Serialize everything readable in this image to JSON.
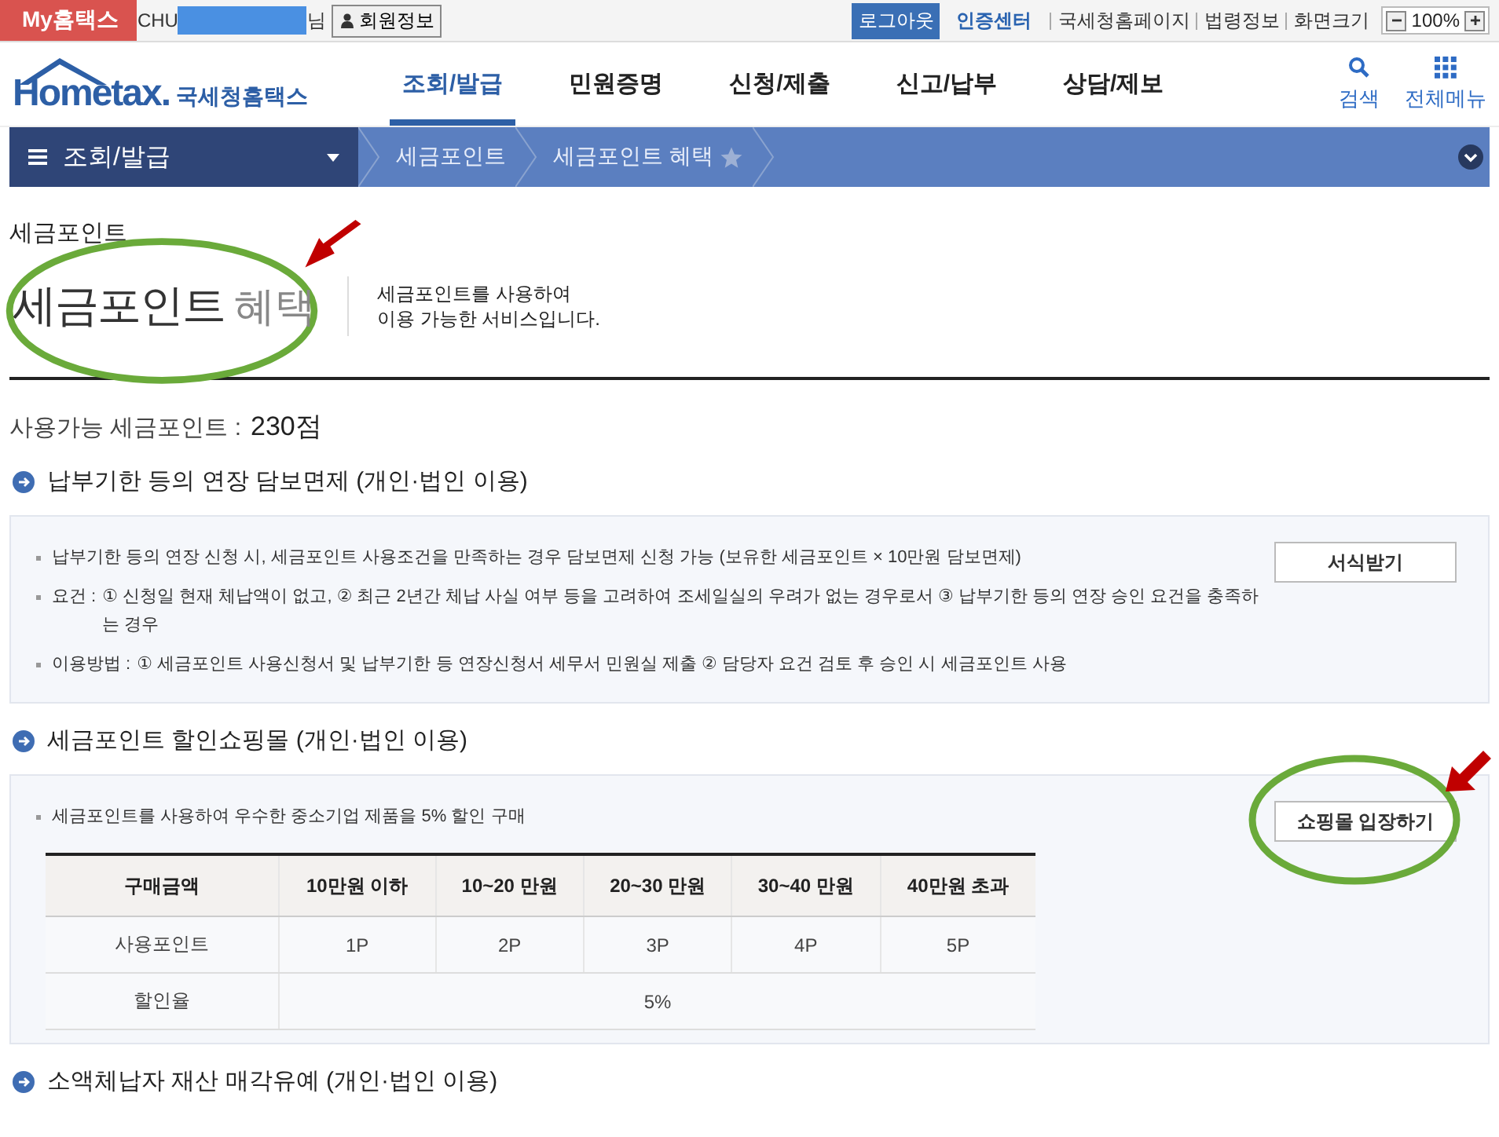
{
  "topbar": {
    "brand": "My홈택스",
    "user": "CHU",
    "user_suffix": "님",
    "member_button": "회원정보",
    "logout": "로그아웃",
    "cert": "인증센터",
    "links": [
      "국세청홈페이지",
      "법령정보",
      "화면크기"
    ],
    "zoom": "100%"
  },
  "header": {
    "logo_text": "Hometax.",
    "logo_name": "국세청홈택스",
    "menu": [
      {
        "label": "조회/발급",
        "selected": true
      },
      {
        "label": "민원증명",
        "selected": false
      },
      {
        "label": "신청/제출",
        "selected": false
      },
      {
        "label": "신고/납부",
        "selected": false
      },
      {
        "label": "상담/제보",
        "selected": false
      }
    ],
    "search": "검색",
    "all_menu": "전체메뉴"
  },
  "breadcrumb": {
    "menu": "조회/발급",
    "items": [
      "세금포인트",
      "세금포인트 혜택"
    ]
  },
  "page": {
    "section_label": "세금포인트",
    "title": "세금포인트",
    "title_sub": "혜택",
    "highlighted": true,
    "description": [
      "세금포인트를 사용하여",
      "이용 가능한 서비스입니다."
    ],
    "points_label": "사용가능 세금포인트 :",
    "points_value": "230점"
  },
  "sections": [
    {
      "title": "납부기한 등의 연장 담보면제 (개인·법인 이용)",
      "button": "서식받기",
      "button_highlighted": false,
      "bullets": [
        {
          "text": "납부기한 등의 연장 신청 시, 세금포인트 사용조건을 만족하는 경우 담보면제 신청 가능 (보유한 세금포인트 × 10만원 담보면제)"
        },
        {
          "label": "요건 :",
          "text": "① 신청일 현재 체납액이 없고, ② 최근 2년간 체납 사실 여부 등을 고려하여 조세일실의 우려가 없는 경우로서 ③ 납부기한 등의 연장 승인 요건을 충족하는 경우"
        },
        {
          "label": "이용방법 :",
          "text": "① 세금포인트 사용신청서 및 납부기한 등 연장신청서 세무서 민원실 제출 ② 담당자 요건 검토 후 승인 시 세금포인트 사용"
        }
      ]
    },
    {
      "title": "세금포인트 할인쇼핑몰 (개인·법인 이용)",
      "button": "쇼핑몰 입장하기",
      "button_highlighted": true,
      "bullets": [
        {
          "text": "세금포인트를 사용하여 우수한 중소기업 제품을 5% 할인 구매"
        }
      ],
      "table": {
        "columns": [
          "구매금액",
          "10만원 이하",
          "10~20 만원",
          "20~30 만원",
          "30~40 만원",
          "40만원 초과"
        ],
        "rows": [
          [
            "사용포인트",
            "1P",
            "2P",
            "3P",
            "4P",
            "5P"
          ],
          [
            "할인율",
            {
              "text": "5%",
              "colspan": 5
            }
          ]
        ]
      }
    },
    {
      "title": "소액체납자 재산 매각유예 (개인·법인 이용)"
    }
  ]
}
